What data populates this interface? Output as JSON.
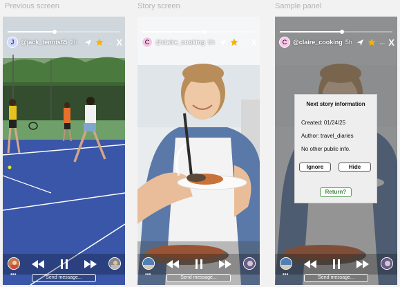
{
  "labels": {
    "previous": "Previous screen",
    "story": "Story screen",
    "sample": "Sample panel"
  },
  "panels": [
    {
      "avatar_letter": "J",
      "avatar_color": "#cfd8ff",
      "username": "@jack_tennis65",
      "time": "2h",
      "progress": 0.42,
      "send_placeholder": "Send message...",
      "more_dots": "...",
      "close": "X"
    },
    {
      "avatar_letter": "C",
      "avatar_color": "#f7c5e6",
      "username": "@claire_cooking",
      "time": "5h",
      "progress": 0.55,
      "send_placeholder": "Send message...",
      "more_dots": "...",
      "close": "X"
    },
    {
      "avatar_letter": "C",
      "avatar_color": "#f7c5e6",
      "username": "@claire_cooking",
      "time": "5h",
      "progress": 0.55,
      "send_placeholder": "Send message...",
      "more_dots": "...",
      "close": "X"
    }
  ],
  "dialog": {
    "title": "Next story information",
    "created": "Created: 01/24/25",
    "author": "Author: travel_diaries",
    "info": "No other public info.",
    "ignore": "Ignore",
    "hide": "Hide",
    "return": "Return?"
  },
  "colors": {
    "star": "#f5b301",
    "return_green": "#3d8a3d"
  },
  "icons": [
    "send-icon",
    "star-icon",
    "more-icon",
    "close-icon",
    "rewind-icon",
    "pause-icon",
    "fast-forward-icon"
  ]
}
